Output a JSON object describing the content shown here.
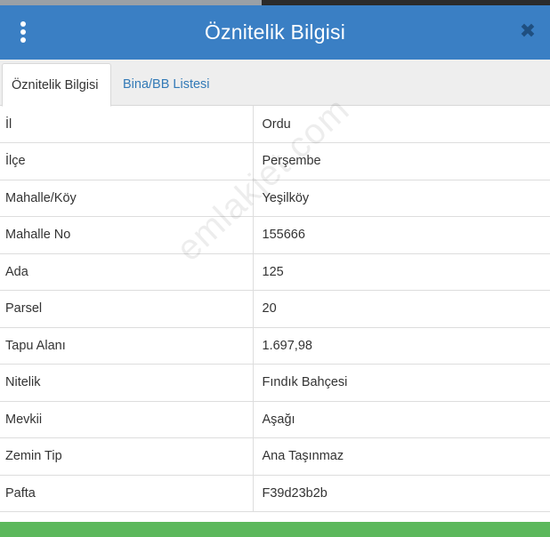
{
  "header": {
    "title": "Öznitelik Bilgisi",
    "menu_icon": "vertical-ellipsis-icon",
    "close_icon": "close-icon",
    "close_glyph": "✖",
    "color": "#3a7fc4"
  },
  "tabs": [
    {
      "label": "Öznitelik Bilgisi",
      "active": true
    },
    {
      "label": "Bina/BB Listesi",
      "active": false
    }
  ],
  "rows": [
    {
      "key": "İl",
      "value": "Ordu"
    },
    {
      "key": "İlçe",
      "value": "Perşembe"
    },
    {
      "key": "Mahalle/Köy",
      "value": "Yeşilköy"
    },
    {
      "key": "Mahalle No",
      "value": "155666"
    },
    {
      "key": "Ada",
      "value": "125"
    },
    {
      "key": "Parsel",
      "value": "20"
    },
    {
      "key": "Tapu Alanı",
      "value": "1.697,98"
    },
    {
      "key": "Nitelik",
      "value": "Fındık Bahçesi"
    },
    {
      "key": "Mevkii",
      "value": "Aşağı"
    },
    {
      "key": "Zemin Tip",
      "value": "Ana Taşınmaz"
    },
    {
      "key": "Pafta",
      "value": "F39d23b2b"
    }
  ],
  "watermark": "emlakjet.com",
  "accent_bar_color": "#5cb85c"
}
